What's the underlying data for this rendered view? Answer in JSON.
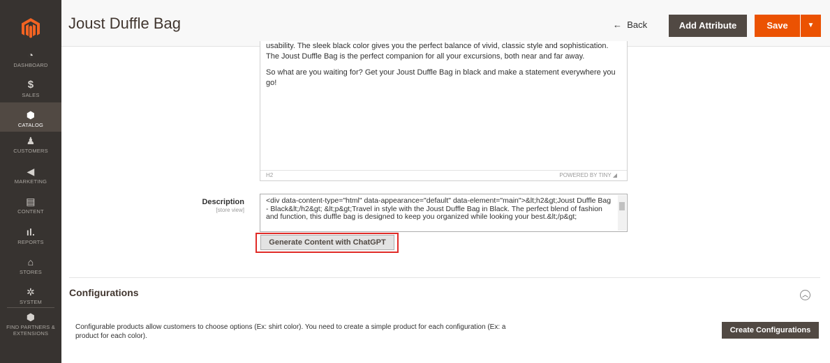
{
  "header": {
    "title": "Joust Duffle Bag",
    "back_label": "Back",
    "add_attribute_label": "Add Attribute",
    "save_label": "Save"
  },
  "sidebar": {
    "items": [
      {
        "label": "DASHBOARD",
        "icon": "dashboard-icon"
      },
      {
        "label": "SALES",
        "icon": "dollar-icon"
      },
      {
        "label": "CATALOG",
        "icon": "cube-icon"
      },
      {
        "label": "CUSTOMERS",
        "icon": "person-icon"
      },
      {
        "label": "MARKETING",
        "icon": "megaphone-icon"
      },
      {
        "label": "CONTENT",
        "icon": "content-icon"
      },
      {
        "label": "REPORTS",
        "icon": "bar-chart-icon"
      },
      {
        "label": "STORES",
        "icon": "store-icon"
      },
      {
        "label": "SYSTEM",
        "icon": "gear-icon"
      },
      {
        "label": "FIND PARTNERS & EXTENSIONS",
        "icon": "extensions-icon"
      }
    ],
    "active": "CATALOG"
  },
  "editor": {
    "paragraph1": "usability. The sleek black color gives you the perfect balance of vivid, classic style and sophistication. The Joust Duffle Bag is the perfect companion for all your excursions, both near and far away.",
    "paragraph2": "So what are you waiting for? Get your Joust Duffle Bag in black and make a statement everywhere you go!",
    "status_path": "H2",
    "powered_by": "POWERED BY TINY"
  },
  "description": {
    "label": "Description",
    "scope": "[store view]",
    "value": "<div data-content-type=\"html\" data-appearance=\"default\" data-element=\"main\">&lt;h2&gt;Joust Duffle Bag - Black&lt;/h2&gt; &lt;p&gt;Travel in style with the Joust Duffle Bag in Black. The perfect blend of fashion and function, this duffle bag is designed to keep you organized while looking your best.&lt;/p&gt;",
    "generate_button": "Generate Content with ChatGPT"
  },
  "configurations": {
    "title": "Configurations",
    "description": "Configurable products allow customers to choose options (Ex: shirt color). You need to create a simple product for each configuration (Ex: a product for each color).",
    "create_button": "Create Configurations"
  },
  "colors": {
    "sidebar_bg": "#373330",
    "accent_orange": "#eb5202",
    "dark_button": "#514943",
    "highlight_red": "#e02b27"
  }
}
